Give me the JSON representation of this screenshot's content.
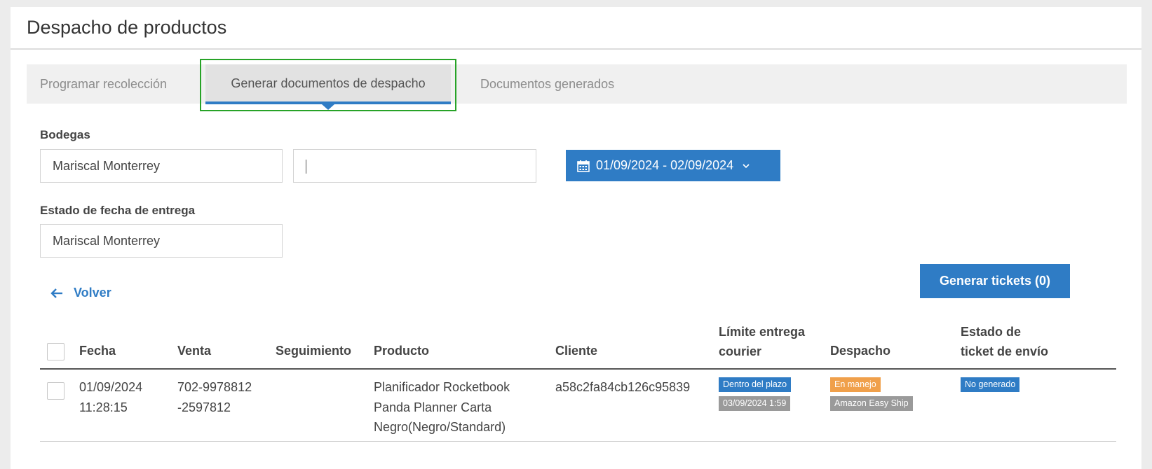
{
  "page": {
    "title": "Despacho de productos"
  },
  "tabs": [
    {
      "label": "Programar recolección",
      "active": false
    },
    {
      "label": "Generar documentos de despacho",
      "active": true
    },
    {
      "label": "Documentos generados",
      "active": false
    }
  ],
  "filters": {
    "bodegas_label": "Bodegas",
    "bodegas_value": "Mariscal Monterrey",
    "second_input_value": "",
    "date_range": "01/09/2024 - 02/09/2024",
    "estado_label": "Estado de fecha de entrega",
    "estado_value": "Mariscal Monterrey"
  },
  "actions": {
    "back_label": "Volver",
    "generate_label": "Generar tickets (0)"
  },
  "table": {
    "headers": {
      "fecha": "Fecha",
      "venta": "Venta",
      "seguimiento": "Seguimiento",
      "producto": "Producto",
      "cliente": "Cliente",
      "limite_1": "Límite entrega",
      "limite_2": "courier",
      "despacho": "Despacho",
      "estado_1": "Estado de",
      "estado_2": "ticket de envío"
    },
    "rows": [
      {
        "fecha_1": "01/09/2024",
        "fecha_2": "11:28:15",
        "venta_1": "702-9978812",
        "venta_2": "-2597812",
        "seguimiento": "",
        "producto_1": "Planificador Rocketbook",
        "producto_2": "Panda Planner Carta",
        "producto_3": "Negro(Negro/Standard)",
        "cliente": "a58c2fa84cb126c95839",
        "limite_badge": "Dentro del plazo",
        "limite_date": "03/09/2024 1:59",
        "despacho_status": "En manejo",
        "despacho_courier": "Amazon Easy Ship",
        "ticket_status": "No generado"
      }
    ]
  },
  "colors": {
    "primary": "#2f7cc5",
    "badge_orange": "#f0a04b",
    "badge_gray": "#9a9a9a",
    "highlight": "#27a327"
  }
}
